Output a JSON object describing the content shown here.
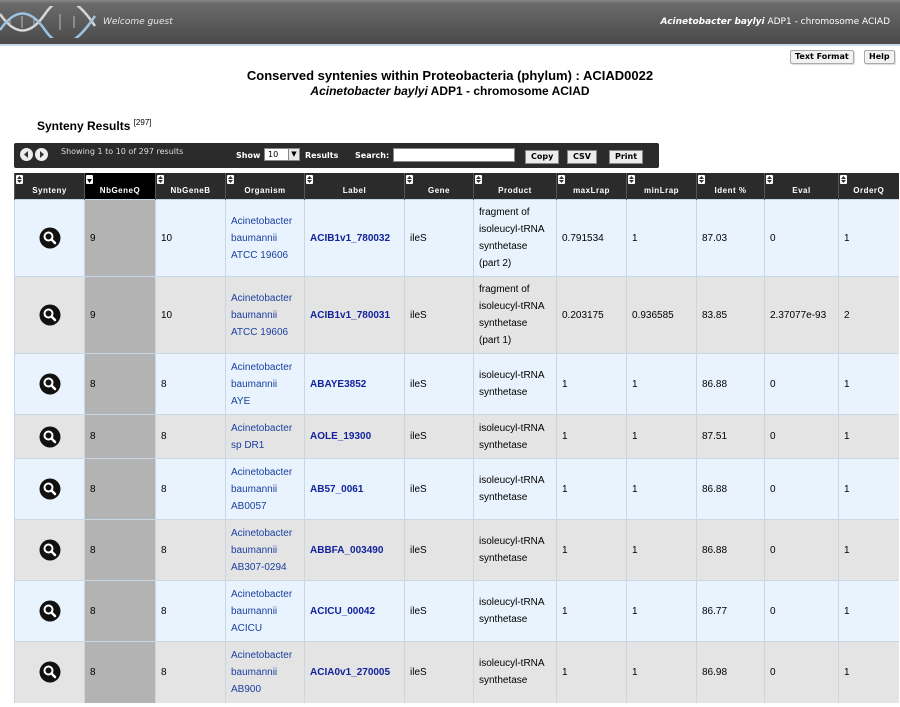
{
  "header": {
    "welcome": "Welcome guest",
    "organism_italic": "Acinetobacter baylyi",
    "organism_rest": " ADP1 - chromosome ACIAD",
    "text_format_label": "Text Format",
    "help_label": "Help"
  },
  "page": {
    "title": "Conserved syntenies within Proteobacteria (phylum) : ACIAD0022",
    "subtitle_italic": "Acinetobacter baylyi",
    "subtitle_rest": " ADP1 - chromosome ACIAD",
    "section_title": "Synteny Results ",
    "section_count": "[297]"
  },
  "toolbar": {
    "info": "Showing 1 to 10 of 297 results",
    "show_label": "Show",
    "show_value": "10",
    "results_label": "Results",
    "search_label": "Search:",
    "search_value": "",
    "copy_label": "Copy",
    "csv_label": "CSV",
    "print_label": "Print"
  },
  "table": {
    "columns": [
      "Synteny",
      "NbGeneQ",
      "NbGeneB",
      "Organism",
      "Label",
      "Gene",
      "Product",
      "maxLrap",
      "minLrap",
      "Ident %",
      "Eval",
      "OrderQ"
    ],
    "rows": [
      {
        "nbq": "9",
        "nbb": "10",
        "org": [
          "Acinetobacter",
          "baumannii",
          "ATCC 19606"
        ],
        "label": "ACIB1v1_780032",
        "gene": "ileS",
        "product": [
          "fragment of",
          "isoleucyl-tRNA",
          "synthetase",
          "(part 2)"
        ],
        "maxlrap": "0.791534",
        "minlrap": "1",
        "ident": "87.03",
        "eval": "0",
        "orderq": "1"
      },
      {
        "nbq": "9",
        "nbb": "10",
        "org": [
          "Acinetobacter",
          "baumannii",
          "ATCC 19606"
        ],
        "label": "ACIB1v1_780031",
        "gene": "ileS",
        "product": [
          "fragment of",
          "isoleucyl-tRNA",
          "synthetase",
          "(part 1)"
        ],
        "maxlrap": "0.203175",
        "minlrap": "0.936585",
        "ident": "83.85",
        "eval": "2.37077e-93",
        "orderq": "2"
      },
      {
        "nbq": "8",
        "nbb": "8",
        "org": [
          "Acinetobacter",
          "baumannii",
          "AYE"
        ],
        "label": "ABAYE3852",
        "gene": "ileS",
        "product": [
          "isoleucyl-tRNA",
          "synthetase"
        ],
        "maxlrap": "1",
        "minlrap": "1",
        "ident": "86.88",
        "eval": "0",
        "orderq": "1"
      },
      {
        "nbq": "8",
        "nbb": "8",
        "org": [
          "Acinetobacter",
          "sp DR1"
        ],
        "label": "AOLE_19300",
        "gene": "ileS",
        "product": [
          "isoleucyl-tRNA",
          "synthetase"
        ],
        "maxlrap": "1",
        "minlrap": "1",
        "ident": "87.51",
        "eval": "0",
        "orderq": "1"
      },
      {
        "nbq": "8",
        "nbb": "8",
        "org": [
          "Acinetobacter",
          "baumannii",
          "AB0057"
        ],
        "label": "AB57_0061",
        "gene": "ileS",
        "product": [
          "isoleucyl-tRNA",
          "synthetase"
        ],
        "maxlrap": "1",
        "minlrap": "1",
        "ident": "86.88",
        "eval": "0",
        "orderq": "1"
      },
      {
        "nbq": "8",
        "nbb": "8",
        "org": [
          "Acinetobacter",
          "baumannii",
          "AB307-0294"
        ],
        "label": "ABBFA_003490",
        "gene": "ileS",
        "product": [
          "isoleucyl-tRNA",
          "synthetase"
        ],
        "maxlrap": "1",
        "minlrap": "1",
        "ident": "86.88",
        "eval": "0",
        "orderq": "1"
      },
      {
        "nbq": "8",
        "nbb": "8",
        "org": [
          "Acinetobacter",
          "baumannii",
          "ACICU"
        ],
        "label": "ACICU_00042",
        "gene": "ileS",
        "product": [
          "isoleucyl-tRNA",
          "synthetase"
        ],
        "maxlrap": "1",
        "minlrap": "1",
        "ident": "86.77",
        "eval": "0",
        "orderq": "1"
      },
      {
        "nbq": "8",
        "nbb": "8",
        "org": [
          "Acinetobacter",
          "baumannii",
          "AB900"
        ],
        "label": "ACIA0v1_270005",
        "gene": "ileS",
        "product": [
          "isoleucyl-tRNA",
          "synthetase"
        ],
        "maxlrap": "1",
        "minlrap": "1",
        "ident": "86.98",
        "eval": "0",
        "orderq": "1"
      }
    ]
  }
}
